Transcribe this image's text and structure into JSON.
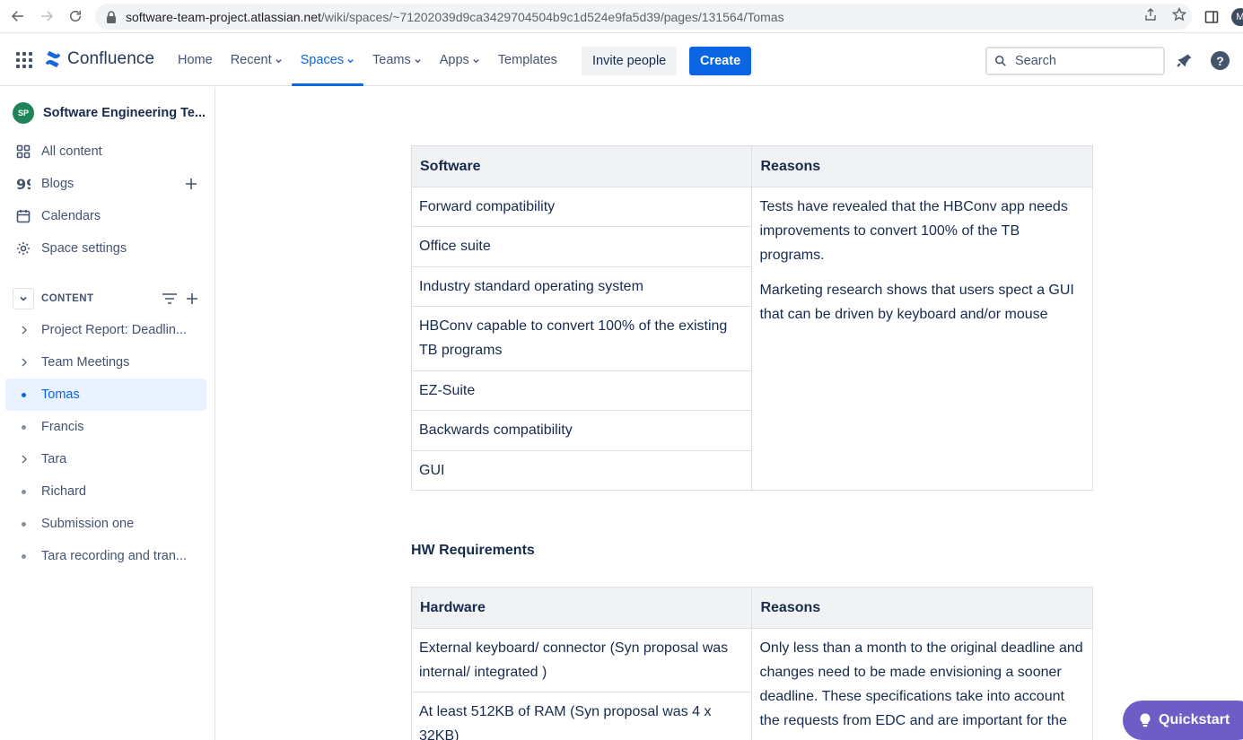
{
  "browser": {
    "url_host": "software-team-project.atlassian.net",
    "url_path": "/wiki/spaces/~71202039d9ca3429704504b9c1d524e9fa5d39/pages/131564/Tomas",
    "profile_initial": "M"
  },
  "topnav": {
    "logo_text": "Confluence",
    "items": [
      {
        "label": "Home"
      },
      {
        "label": "Recent"
      },
      {
        "label": "Spaces"
      },
      {
        "label": "Teams"
      },
      {
        "label": "Apps"
      },
      {
        "label": "Templates"
      }
    ],
    "invite_label": "Invite people",
    "create_label": "Create",
    "search_placeholder": "Search"
  },
  "sidebar": {
    "space_initials": "SP",
    "space_name": "Software Engineering Te...",
    "links": [
      {
        "label": "All content",
        "icon": "grid-icon"
      },
      {
        "label": "Blogs",
        "icon": "quote-icon"
      },
      {
        "label": "Calendars",
        "icon": "calendar-icon"
      },
      {
        "label": "Space settings",
        "icon": "gear-icon"
      }
    ],
    "content_label": "CONTENT",
    "tree": [
      {
        "label": "Project Report: Deadlin...",
        "type": "expand"
      },
      {
        "label": "Team Meetings",
        "type": "expand"
      },
      {
        "label": "Tomas",
        "type": "dot",
        "selected": true
      },
      {
        "label": "Francis",
        "type": "dot"
      },
      {
        "label": "Tara",
        "type": "expand"
      },
      {
        "label": "Richard",
        "type": "dot"
      },
      {
        "label": "Submission one",
        "type": "dot"
      },
      {
        "label": "Tara recording and tran...",
        "type": "dot"
      }
    ]
  },
  "main": {
    "sw_table": {
      "headers": [
        "Software",
        "Reasons"
      ],
      "rows": [
        "Forward compatibility",
        "Office suite",
        "Industry standard operating system",
        "HBConv capable to convert 100% of the existing TB programs",
        "EZ-Suite",
        "Backwards compatibility",
        "GUI"
      ],
      "reasons": [
        "Tests have revealed that the HBConv app needs improvements to convert 100% of the TB programs.",
        "Marketing research shows that users spect a GUI that can be driven by keyboard and/or mouse"
      ]
    },
    "hw_heading": "HW Requirements",
    "hw_table": {
      "headers": [
        "Hardware",
        "Reasons"
      ],
      "rows": [
        "External keyboard/ connector (Syn proposal was internal/ integrated )",
        "At least 512KB of RAM (Syn proposal was 4 x 32KB)"
      ],
      "reasons": [
        "Only less than a month to the original deadline and changes need to be made envisioning  a sooner deadline. These specifications take into account the requests from EDC and are important for the"
      ]
    }
  },
  "quickstart_label": "Quickstart"
}
